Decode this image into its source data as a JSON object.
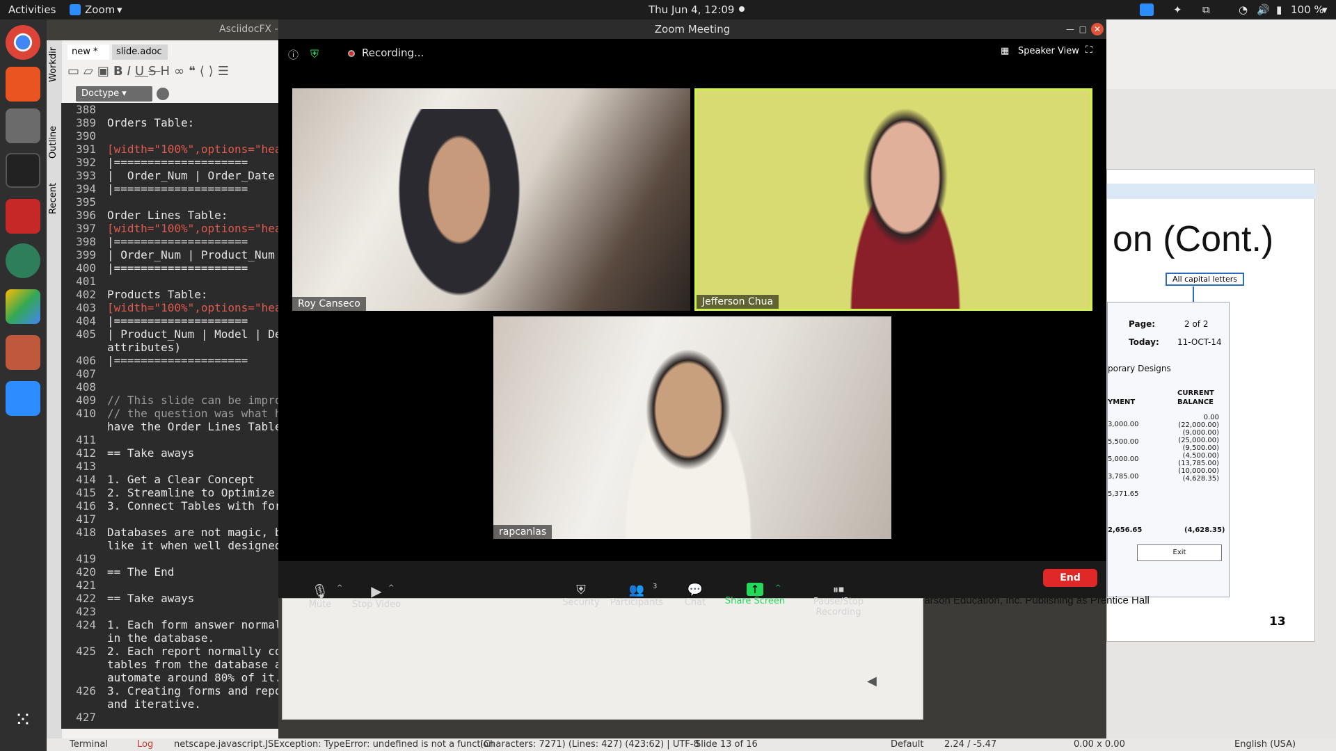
{
  "topbar": {
    "activities": "Activities",
    "app": "Zoom",
    "datetime": "Thu Jun  4, 12:09",
    "battery": "100 %"
  },
  "editor": {
    "title": "AsciidocFX -",
    "tabs": [
      "new *",
      "slide.adoc"
    ],
    "side_tabs": [
      "Workdir",
      "Outline",
      "Recent"
    ],
    "doctype": "Doctype",
    "lines": [
      {
        "n": "388",
        "t": ""
      },
      {
        "n": "389",
        "t": "Orders Table:"
      },
      {
        "n": "390",
        "t": ""
      },
      {
        "n": "391",
        "t": "[width=\"100%\",options=\"hea"
      },
      {
        "n": "392",
        "t": "|===================="
      },
      {
        "n": "393",
        "t": "|  Order_Num | Order_Date"
      },
      {
        "n": "394",
        "t": "|===================="
      },
      {
        "n": "395",
        "t": ""
      },
      {
        "n": "396",
        "t": "Order Lines Table:"
      },
      {
        "n": "397",
        "t": "[width=\"100%\",options=\"hea"
      },
      {
        "n": "398",
        "t": "|===================="
      },
      {
        "n": "399",
        "t": "| Order_Num | Product_Num"
      },
      {
        "n": "400",
        "t": "|===================="
      },
      {
        "n": "401",
        "t": ""
      },
      {
        "n": "402",
        "t": "Products Table:"
      },
      {
        "n": "403",
        "t": "[width=\"100%\",options=\"hea"
      },
      {
        "n": "404",
        "t": "|===================="
      },
      {
        "n": "405",
        "t": "| Product_Num | Model | De"
      },
      {
        "n": "",
        "t": "attributes)"
      },
      {
        "n": "406",
        "t": "|===================="
      },
      {
        "n": "407",
        "t": ""
      },
      {
        "n": "408",
        "t": ""
      },
      {
        "n": "409",
        "t": "// This slide can be impro"
      },
      {
        "n": "410",
        "t": "// the question was what h"
      },
      {
        "n": "",
        "t": "have the Order Lines Table"
      },
      {
        "n": "411",
        "t": ""
      },
      {
        "n": "412",
        "t": "== Take aways"
      },
      {
        "n": "413",
        "t": ""
      },
      {
        "n": "414",
        "t": "1. Get a Clear Concept"
      },
      {
        "n": "415",
        "t": "2. Streamline to Optimize"
      },
      {
        "n": "416",
        "t": "3. Connect Tables with for"
      },
      {
        "n": "417",
        "t": ""
      },
      {
        "n": "418",
        "t": "Databases are not magic, b"
      },
      {
        "n": "",
        "t": "like it when well designed"
      },
      {
        "n": "419",
        "t": ""
      },
      {
        "n": "420",
        "t": "== The End"
      },
      {
        "n": "421",
        "t": ""
      },
      {
        "n": "422",
        "t": "== Take aways"
      },
      {
        "n": "423",
        "t": ""
      },
      {
        "n": "424",
        "t": "1. Each form answer normal"
      },
      {
        "n": "",
        "t": "in the database."
      },
      {
        "n": "425",
        "t": "2. Each report normally co"
      },
      {
        "n": "",
        "t": "tables from the database a"
      },
      {
        "n": "",
        "t": "automate around 80% of it."
      },
      {
        "n": "426",
        "t": "3. Creating forms and repo"
      },
      {
        "n": "",
        "t": "and iterative."
      },
      {
        "n": "427",
        "t": ""
      }
    ]
  },
  "zoom": {
    "title": "Zoom Meeting",
    "recording": "Recording...",
    "view": "Speaker View",
    "participants": [
      {
        "name": "Roy Canseco"
      },
      {
        "name": "Jefferson Chua"
      },
      {
        "name": "rapcanlas"
      }
    ],
    "toolbar": {
      "mute": "Mute",
      "video": "Stop Video",
      "security": "Security",
      "participants": "Participants",
      "participants_count": "3",
      "chat": "Chat",
      "share": "Share Screen",
      "record": "Pause/Stop Recording",
      "end": "End"
    }
  },
  "slide": {
    "title": "on (Cont.)",
    "callout": "All capital letters",
    "page_label": "Page:",
    "page_value": "2 of 2",
    "today_label": "Today:",
    "today_value": "11-OCT-14",
    "company": "porary Designs",
    "col1": "YMENT",
    "col2a": "CURRENT",
    "col2b": "BALANCE",
    "balances": [
      "0.00",
      "(22,000.00)",
      "(9,000.00)",
      "(25,000.00)",
      "(9,500.00)",
      "(4,500.00)",
      "(13,785.00)",
      "(10,000.00)",
      "(4,628.35)"
    ],
    "payments": [
      "3,000.00",
      "5,500.00",
      "5,000.00",
      "3,785.00",
      "5,371.65"
    ],
    "total_pay": "2,656.65",
    "total_bal": "(4,628.35)",
    "exit": "Exit",
    "footer": "earson Education, Inc. Publishing as Prentice Hall",
    "page_num": "13"
  },
  "status": {
    "terminal": "Terminal",
    "log": "Log",
    "error": "netscape.javascript.JSException: TypeError: undefined is not a function",
    "stats": "(Characters: 7271) (Lines: 427) (423:62) | UTF-8",
    "slide": "Slide 13 of 16",
    "layout": "Default",
    "pos": "2.24 / -5.47",
    "size": "0.00 x 0.00",
    "lang": "English (USA)"
  }
}
